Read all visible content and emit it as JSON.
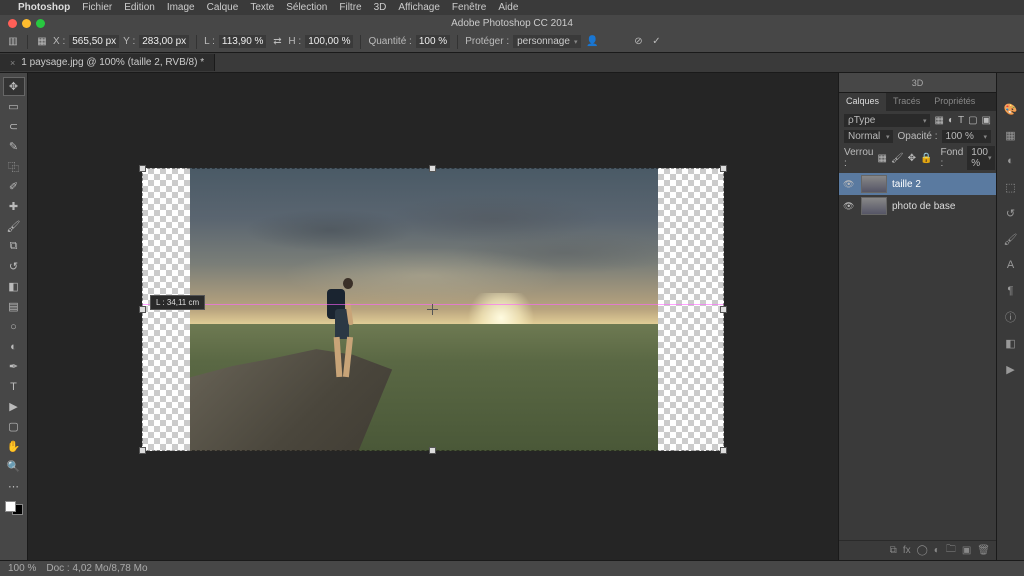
{
  "menu": {
    "apple": "",
    "items": [
      "Photoshop",
      "Fichier",
      "Edition",
      "Image",
      "Calque",
      "Texte",
      "Sélection",
      "Filtre",
      "3D",
      "Affichage",
      "Fenêtre",
      "Aide"
    ]
  },
  "window": {
    "title": "Adobe Photoshop CC 2014"
  },
  "options": {
    "x_label": "X :",
    "x_value": "565,50 px",
    "y_label": "Y :",
    "y_value": "283,00 px",
    "l_label": "L :",
    "l_value": "113,90 %",
    "h_label": "H :",
    "h_value": "100,00 %",
    "q_label": "Quantité :",
    "q_value": "100 %",
    "protect_label": "Protéger :",
    "protect_value": "personnage"
  },
  "tab": {
    "title": "1 paysage.jpg @ 100% (taille 2, RVB/8) *"
  },
  "measure": {
    "badge": "L : 34,11 cm"
  },
  "threed": {
    "label": "3D"
  },
  "panel": {
    "tabs": [
      "Calques",
      "Tracés",
      "Propriétés"
    ],
    "filter": "ρType",
    "blend_mode": "Normal",
    "opacity_label": "Opacité :",
    "opacity_value": "100 %",
    "lock_label": "Verrou :",
    "fill_label": "Fond :",
    "fill_value": "100 %",
    "layers": [
      {
        "name": "taille 2",
        "selected": true
      },
      {
        "name": "photo de base",
        "selected": false
      }
    ]
  },
  "status": {
    "zoom": "100 %",
    "docinfo": "Doc : 4,02 Mo/8,78 Mo"
  }
}
